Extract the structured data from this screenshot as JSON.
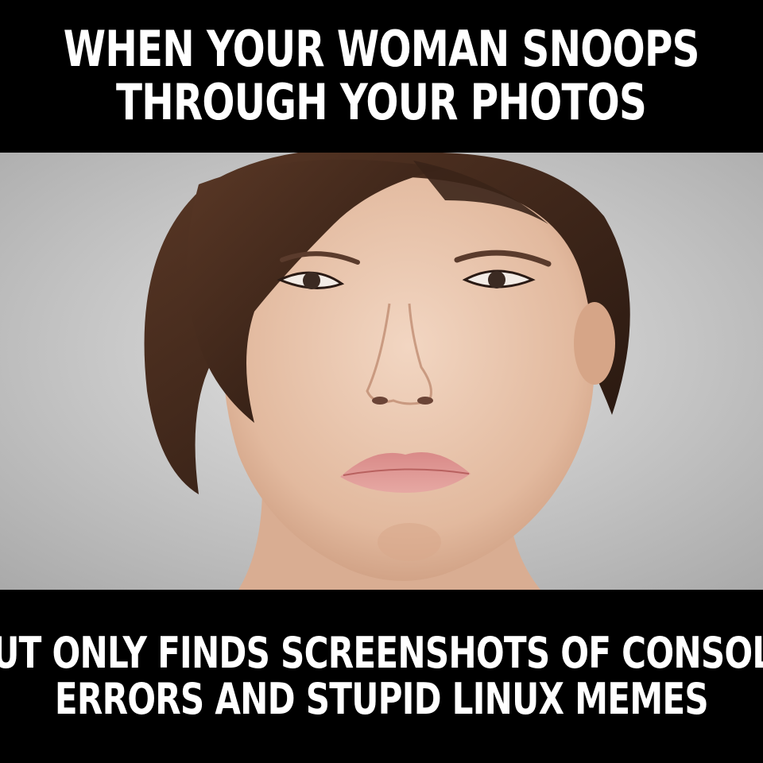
{
  "top_caption": {
    "line1": "WHEN YOUR WOMAN SNOOPS",
    "line2": "THROUGH YOUR PHOTOS"
  },
  "bottom_caption": {
    "line1": "BUT ONLY FINDS SCREENSHOTS OF CONSOLE",
    "line2": "ERRORS AND STUPID LINUX MEMES"
  },
  "colors": {
    "caption_background": "#000000",
    "caption_text": "#ffffff",
    "photo_background": "#c9c9c9",
    "hair": "#3a2418",
    "skin": "#e6c2a8",
    "lips": "#d98c8c"
  }
}
